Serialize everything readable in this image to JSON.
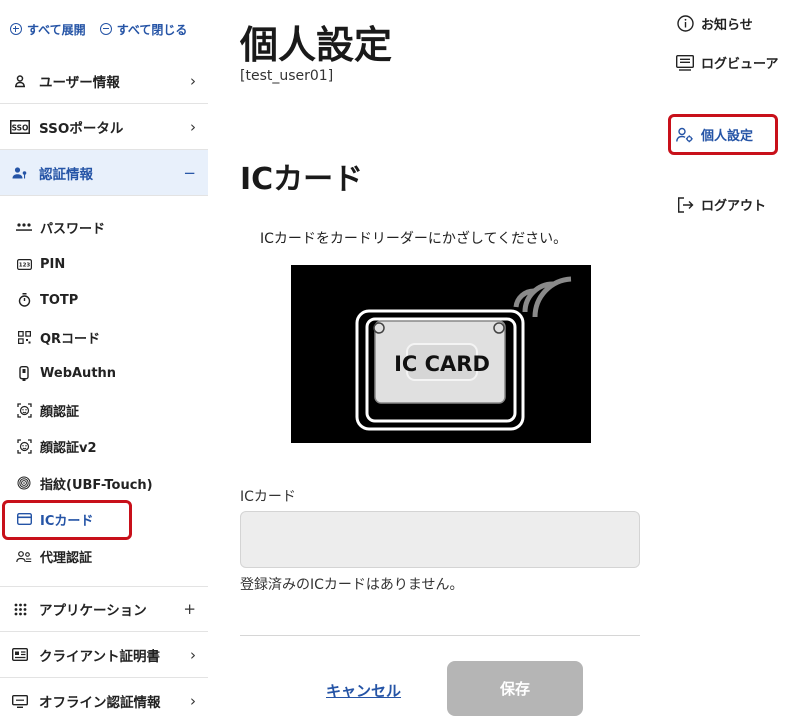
{
  "sidebar": {
    "expand_all": "すべて展開",
    "collapse_all": "すべて閉じる",
    "user_info": "ユーザー情報",
    "sso_portal": "SSOポータル",
    "auth_info": "認証情報",
    "sub_items": [
      "パスワード",
      "PIN",
      "TOTP",
      "QRコード",
      "WebAuthn",
      "顔認証",
      "顔認証v2",
      "指紋(UBF-Touch)",
      "ICカード",
      "代理認証"
    ],
    "applications": "アプリケーション",
    "client_cert": "クライアント証明書",
    "offline_auth": "オフライン認証情報",
    "icon_sso": "SSO",
    "icon_pin": "123"
  },
  "main": {
    "title": "個人設定",
    "user_id": "[test_user01]",
    "section_title": "ICカード",
    "instruction": "ICカードをカードリーダーにかざしてください。",
    "card_image_label": "IC CARD",
    "field_label": "ICカード",
    "field_value": "",
    "field_note": "登録済みのICカードはありません。",
    "cancel": "キャンセル",
    "save": "保存"
  },
  "right_nav": {
    "notice": "お知らせ",
    "log_viewer": "ログビューア",
    "personal_settings": "個人設定",
    "logout": "ログアウト"
  },
  "colors": {
    "accent": "#2554a6",
    "highlight": "#c8101a",
    "active_bg": "#e8f0fb",
    "disabled": "#b5b5b5"
  }
}
